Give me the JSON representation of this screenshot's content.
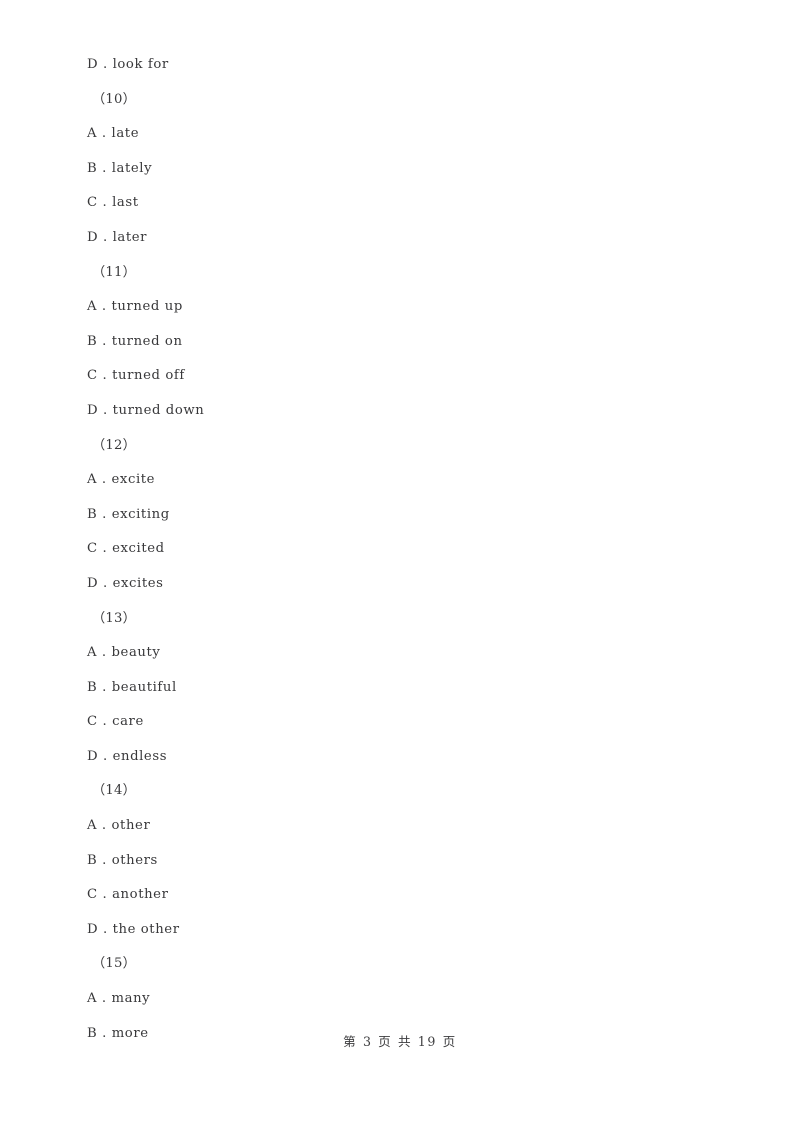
{
  "document": {
    "type": "scanned-exam-page",
    "background_color": "#ffffff",
    "text_color": "#38383a"
  },
  "body_lines": [
    {
      "kind": "option",
      "letter": "D",
      "separator": " . ",
      "text": "look for"
    },
    {
      "kind": "question",
      "label": "（10）"
    },
    {
      "kind": "option",
      "letter": "A",
      "separator": " . ",
      "text": "late"
    },
    {
      "kind": "option",
      "letter": "B",
      "separator": " . ",
      "text": "lately"
    },
    {
      "kind": "option",
      "letter": "C",
      "separator": " . ",
      "text": "last"
    },
    {
      "kind": "option",
      "letter": "D",
      "separator": " . ",
      "text": "later"
    },
    {
      "kind": "question",
      "label": "（11）"
    },
    {
      "kind": "option",
      "letter": "A",
      "separator": " . ",
      "text": "turned up"
    },
    {
      "kind": "option",
      "letter": "B",
      "separator": " . ",
      "text": "turned on"
    },
    {
      "kind": "option",
      "letter": "C",
      "separator": " . ",
      "text": "turned off"
    },
    {
      "kind": "option",
      "letter": "D",
      "separator": " . ",
      "text": "turned down"
    },
    {
      "kind": "question",
      "label": "（12）"
    },
    {
      "kind": "option",
      "letter": "A",
      "separator": " . ",
      "text": "excite"
    },
    {
      "kind": "option",
      "letter": "B",
      "separator": " . ",
      "text": "exciting"
    },
    {
      "kind": "option",
      "letter": "C",
      "separator": " . ",
      "text": "excited"
    },
    {
      "kind": "option",
      "letter": "D",
      "separator": " . ",
      "text": "excites"
    },
    {
      "kind": "question",
      "label": "（13）"
    },
    {
      "kind": "option",
      "letter": "A",
      "separator": " . ",
      "text": "beauty"
    },
    {
      "kind": "option",
      "letter": "B",
      "separator": " . ",
      "text": "beautiful"
    },
    {
      "kind": "option",
      "letter": "C",
      "separator": " . ",
      "text": "care"
    },
    {
      "kind": "option",
      "letter": "D",
      "separator": " . ",
      "text": "endless"
    },
    {
      "kind": "question",
      "label": "（14）"
    },
    {
      "kind": "option",
      "letter": "A",
      "separator": " . ",
      "text": "other"
    },
    {
      "kind": "option",
      "letter": "B",
      "separator": " . ",
      "text": "others"
    },
    {
      "kind": "option",
      "letter": "C",
      "separator": " . ",
      "text": "another"
    },
    {
      "kind": "option",
      "letter": "D",
      "separator": " . ",
      "text": "the other"
    },
    {
      "kind": "question",
      "label": "（15）"
    },
    {
      "kind": "option",
      "letter": "A",
      "separator": " . ",
      "text": "many"
    },
    {
      "kind": "option",
      "letter": "B",
      "separator": " . ",
      "text": "more"
    }
  ],
  "footer": {
    "text": "第 3 页 共 19 页",
    "current_page": "3",
    "total_pages": "19"
  }
}
